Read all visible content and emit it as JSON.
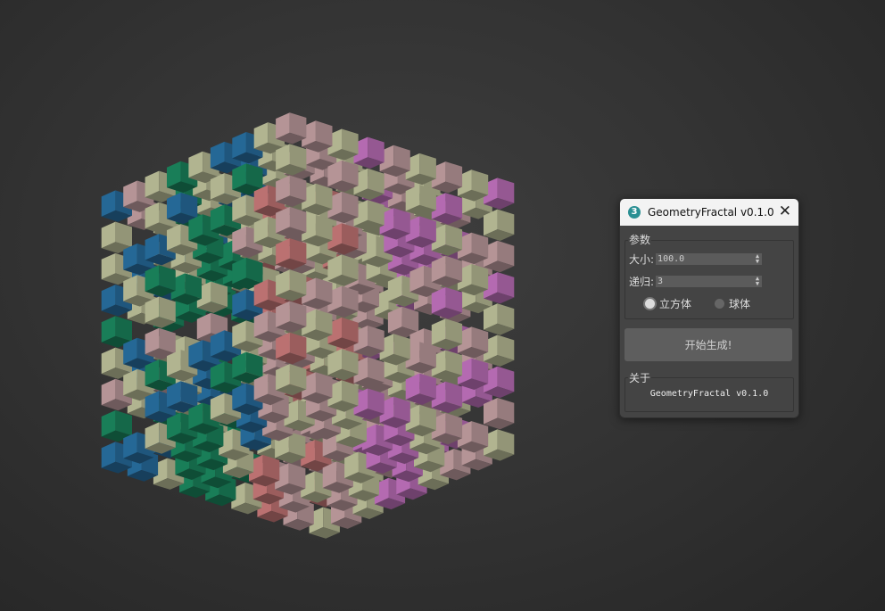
{
  "viewport": {
    "scene": "menger-fractal-cubes",
    "palette": [
      "#1f9a6c",
      "#2e7fb8",
      "#d9dcb0",
      "#ddb5b8",
      "#e58a8a",
      "#dc82d8",
      "#b9d2b0"
    ]
  },
  "dialog": {
    "icon": "3",
    "title": "GeometryFractal v0.1.0",
    "close_icon": "✕",
    "params_group": "参数",
    "size_label": "大小:",
    "size_value": "100.0",
    "recursion_label": "递归:",
    "recursion_value": "3",
    "shape_options": [
      {
        "label": "立方体",
        "selected": true
      },
      {
        "label": "球体",
        "selected": false
      }
    ],
    "generate_button": "开始生成!",
    "about_group": "关于",
    "about_text": "GeometryFractal v0.1.0"
  }
}
